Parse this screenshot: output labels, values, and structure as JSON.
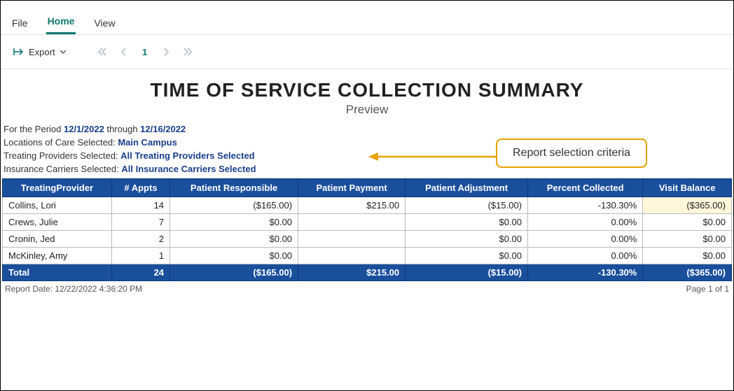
{
  "menu": {
    "file": "File",
    "home": "Home",
    "view": "View"
  },
  "toolbar": {
    "export": "Export",
    "current_page": "1"
  },
  "report": {
    "title": "TIME OF SERVICE COLLECTION SUMMARY",
    "subtitle": "Preview"
  },
  "criteria": {
    "period_label": "For the Period ",
    "period_from": "12/1/2022",
    "period_through_label": " through ",
    "period_to": "12/16/2022",
    "location_label": "Locations of Care Selected: ",
    "location_value": "Main Campus",
    "providers_label": "Treating Providers Selected: ",
    "providers_value": "All Treating Providers Selected",
    "carriers_label": "Insurance Carriers Selected: ",
    "carriers_value": "All Insurance Carriers Selected"
  },
  "table": {
    "headers": [
      "TreatingProvider",
      "# Appts",
      "Patient Responsible",
      "Patient Payment",
      "Patient  Adjustment",
      "Percent Collected",
      "Visit Balance"
    ],
    "rows": [
      {
        "cells": [
          "Collins, Lori",
          "14",
          "($165.00)",
          "$215.00",
          "($15.00)",
          "-130.30%",
          "($365.00)"
        ],
        "highlight_last": true
      },
      {
        "cells": [
          "Crews, Julie",
          "7",
          "$0.00",
          "",
          "$0.00",
          "0.00%",
          "$0.00"
        ]
      },
      {
        "cells": [
          "Cronin, Jed",
          "2",
          "$0.00",
          "",
          "$0.00",
          "0.00%",
          "$0.00"
        ]
      },
      {
        "cells": [
          "McKinley, Amy",
          "1",
          "$0.00",
          "",
          "$0.00",
          "0.00%",
          "$0.00"
        ]
      }
    ],
    "total": [
      "Total",
      "24",
      "($165.00)",
      "$215.00",
      "($15.00)",
      "-130.30%",
      "($365.00)"
    ]
  },
  "footer": {
    "report_date": "Report Date: 12/22/2022 4:36:20 PM",
    "page_label": "Page 1 of 1"
  },
  "annotation": {
    "text": "Report selection criteria"
  }
}
